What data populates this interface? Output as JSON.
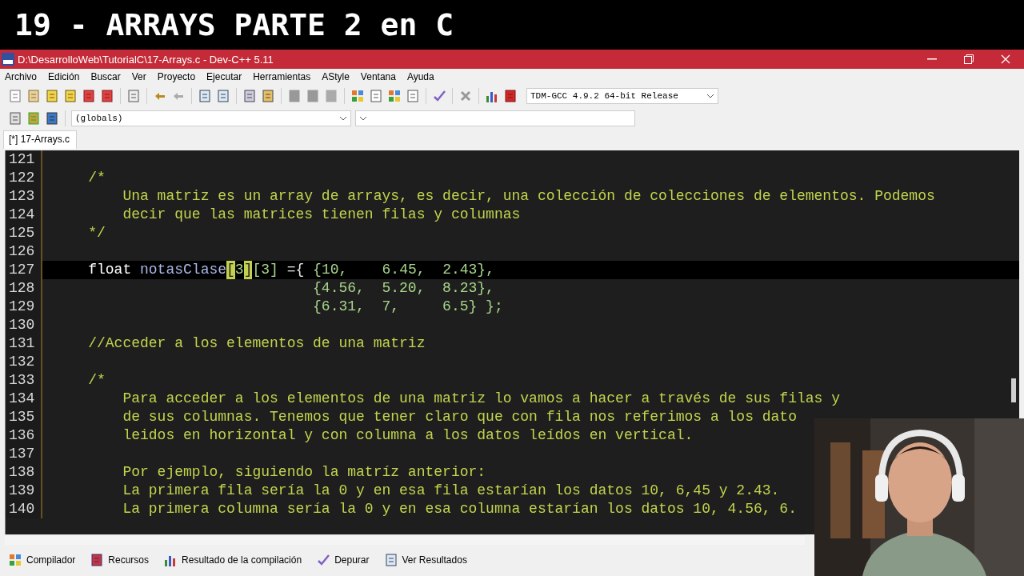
{
  "banner": {
    "title": "19 - ARRAYS PARTE 2 en C"
  },
  "window": {
    "title": "D:\\DesarrolloWeb\\TutorialC\\17-Arrays.c - Dev-C++ 5.11"
  },
  "menu": [
    "Archivo",
    "Edición",
    "Buscar",
    "Ver",
    "Proyecto",
    "Ejecutar",
    "Herramientas",
    "AStyle",
    "Ventana",
    "Ayuda"
  ],
  "compiler_select": {
    "value": "TDM-GCC 4.9.2 64-bit Release"
  },
  "scope_select": {
    "value": "(globals)"
  },
  "tabs": [
    {
      "label": "[*] 17-Arrays.c",
      "selected": true
    }
  ],
  "editor": {
    "lines": [
      {
        "number": "121",
        "current": false
      },
      {
        "number": "122",
        "current": false,
        "segments": [
          {
            "text": "    /*",
            "kind": "comment"
          }
        ]
      },
      {
        "number": "123",
        "current": false,
        "segments": [
          {
            "text": "        Una matriz es un array de arrays, es decir, una colección de colecciones de elementos. Podemos",
            "kind": "comment"
          }
        ]
      },
      {
        "number": "124",
        "current": false,
        "segments": [
          {
            "text": "        decir que las matrices tienen filas y columnas",
            "kind": "comment"
          }
        ]
      },
      {
        "number": "125",
        "current": false,
        "segments": [
          {
            "text": "    */",
            "kind": "comment"
          }
        ]
      },
      {
        "number": "126",
        "current": false
      },
      {
        "number": "127",
        "current": true,
        "segments": [
          {
            "text": "    float",
            "kind": "keyword"
          },
          {
            "text": " notasClase",
            "kind": "ident"
          },
          {
            "text": "[",
            "kind": "match"
          },
          {
            "text": "3",
            "kind": "number"
          },
          {
            "text": "]",
            "kind": "match"
          },
          {
            "text": "[3]",
            "kind": "number"
          },
          {
            "text": " ={ ",
            "kind": "symbol"
          },
          {
            "text": "{10,    6.45,  2.43},",
            "kind": "number"
          }
        ]
      },
      {
        "number": "128",
        "current": false,
        "segments": [
          {
            "text": "                              {4.56,  5.20,  8.23},",
            "kind": "number"
          }
        ]
      },
      {
        "number": "129",
        "current": false,
        "segments": [
          {
            "text": "                              {6.31,  7,     6.5} };",
            "kind": "number"
          }
        ]
      },
      {
        "number": "130",
        "current": false
      },
      {
        "number": "131",
        "current": false,
        "segments": [
          {
            "text": "    //Acceder a los elementos de una matriz",
            "kind": "comment"
          }
        ]
      },
      {
        "number": "132",
        "current": false
      },
      {
        "number": "133",
        "current": false,
        "segments": [
          {
            "text": "    /*",
            "kind": "comment"
          }
        ]
      },
      {
        "number": "134",
        "current": false,
        "segments": [
          {
            "text": "        Para acceder a los elementos de una matriz lo vamos a hacer a través de sus filas y",
            "kind": "comment"
          }
        ]
      },
      {
        "number": "135",
        "current": false,
        "segments": [
          {
            "text": "        de sus columnas. Tenemos que tener claro que con fila nos referimos a los dato",
            "kind": "comment"
          }
        ]
      },
      {
        "number": "136",
        "current": false,
        "segments": [
          {
            "text": "        leidos en horizontal y con columna a los datos leídos en vertical.",
            "kind": "comment"
          }
        ]
      },
      {
        "number": "137",
        "current": false
      },
      {
        "number": "138",
        "current": false,
        "segments": [
          {
            "text": "        Por ejemplo, siguiendo la matríz anterior:",
            "kind": "comment"
          }
        ]
      },
      {
        "number": "139",
        "current": false,
        "segments": [
          {
            "text": "        La primera fila sería la 0 y en esa fila estarían los datos 10, 6,45 y 2.43.",
            "kind": "comment"
          }
        ]
      },
      {
        "number": "140",
        "current": false,
        "segments": [
          {
            "text": "        La primera columna sería la 0 y en esa columna estarían los datos 10, 4.56, 6.",
            "kind": "comment"
          }
        ]
      }
    ]
  },
  "bottom_tabs": [
    {
      "label": "Compilador",
      "selected": false
    },
    {
      "label": "Recursos",
      "selected": false
    },
    {
      "label": "Resultado de la compilación",
      "selected": false
    },
    {
      "label": "Depurar",
      "selected": false
    },
    {
      "label": "Ver Resultados",
      "selected": false
    }
  ]
}
